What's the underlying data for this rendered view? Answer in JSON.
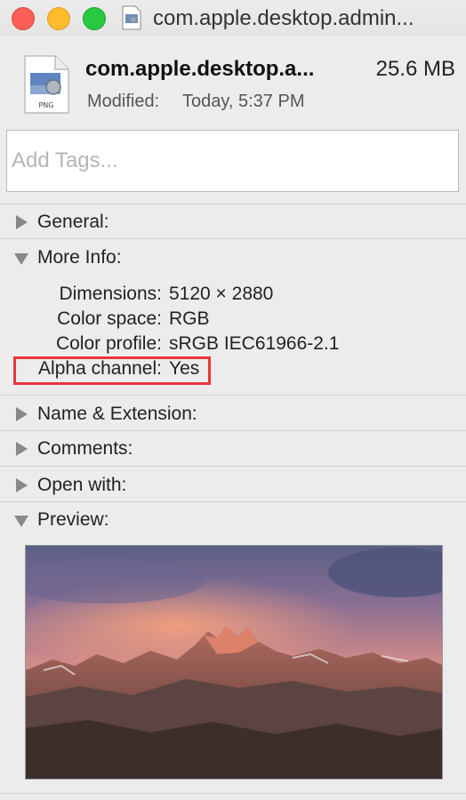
{
  "window": {
    "title": "com.apple.desktop.admin...",
    "title_icon": "document-icon"
  },
  "file": {
    "name": "com.apple.desktop.a...",
    "size": "25.6 MB",
    "modified_label": "Modified:",
    "modified_value": "Today, 5:37 PM",
    "icon_label": "PNG"
  },
  "tags": {
    "placeholder": "Add Tags..."
  },
  "sections": {
    "general": "General:",
    "more_info": "More Info:",
    "name_extension": "Name & Extension:",
    "comments": "Comments:",
    "open_with": "Open with:",
    "preview": "Preview:"
  },
  "more_info": {
    "rows": [
      {
        "label": "Dimensions:",
        "value": "5120 × 2880"
      },
      {
        "label": "Color space:",
        "value": "RGB"
      },
      {
        "label": "Color profile:",
        "value": "sRGB IEC61966-2.1"
      },
      {
        "label": "Alpha channel:",
        "value": "Yes"
      }
    ]
  },
  "colors": {
    "close": "#fc5f57",
    "minimize": "#fdbc2e",
    "maximize": "#28c840",
    "highlight": "#e8373a"
  }
}
